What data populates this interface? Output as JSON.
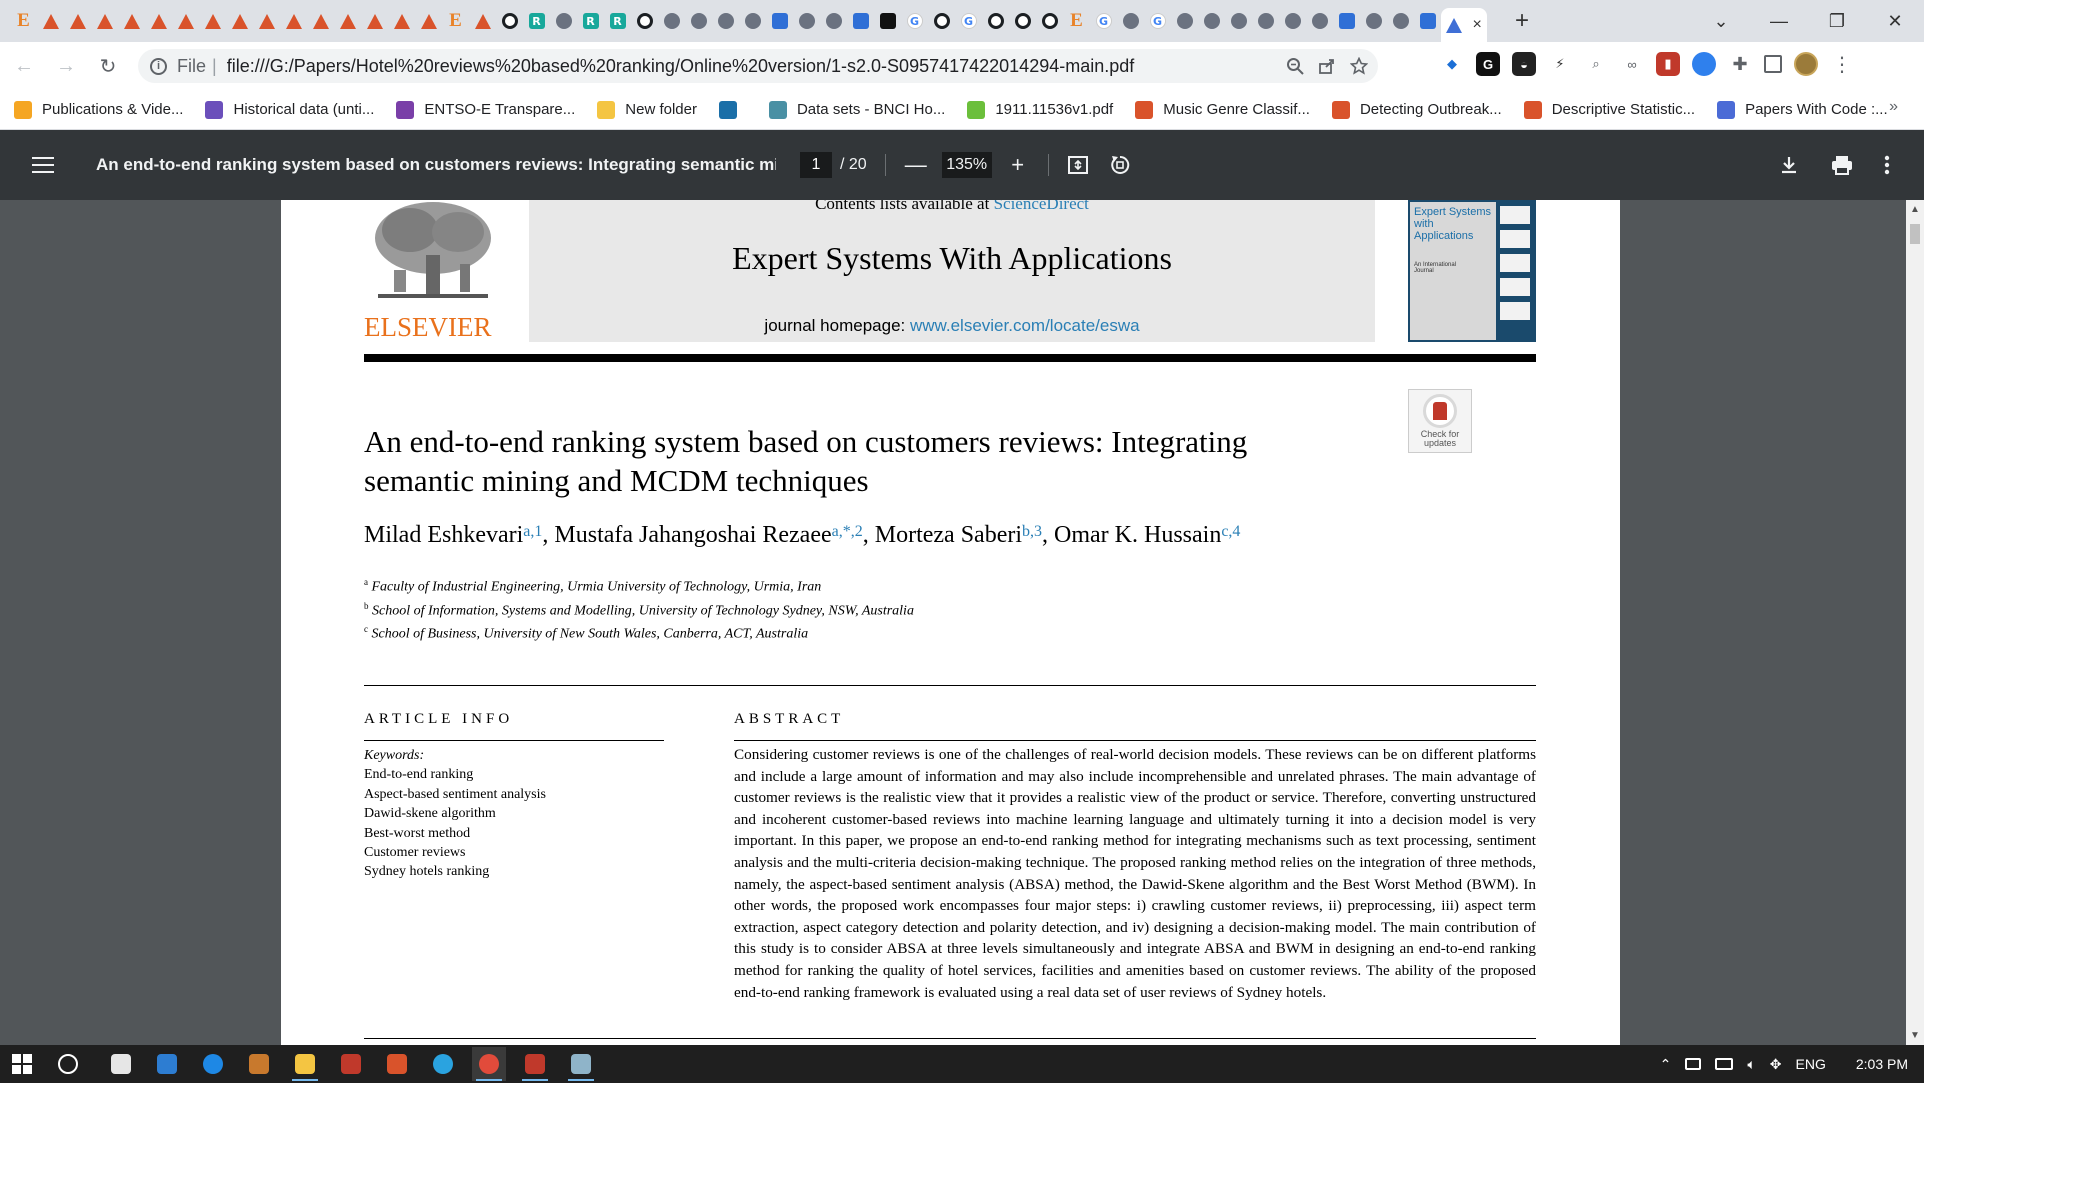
{
  "browser": {
    "tabs": [
      "E",
      "matlab",
      "matlab",
      "matlab",
      "matlab",
      "matlab",
      "matlab",
      "matlab",
      "matlab",
      "matlab",
      "matlab",
      "matlab",
      "matlab",
      "matlab",
      "matlab",
      "matlab",
      "E",
      "matlab",
      "gh",
      "rg",
      "page",
      "rg",
      "rg",
      "gh",
      "globe",
      "globe",
      "globe",
      "globe",
      "blue",
      "globe",
      "globe",
      "blue",
      "dark",
      "g",
      "gh",
      "g",
      "gh",
      "gh",
      "gh",
      "E",
      "g",
      "globe",
      "g",
      "globe",
      "globe",
      "globe",
      "globe",
      "globe",
      "globe",
      "blue",
      "globe",
      "globe",
      "blue"
    ],
    "active_tab_close": "×",
    "new_tab": "+",
    "window_controls": {
      "tab_search": "⌄",
      "minimize": "—",
      "restore": "❐",
      "close": "✕"
    },
    "nav": {
      "back": "←",
      "forward": "→",
      "reload": "↻"
    },
    "omnibox": {
      "scheme": "File",
      "url": "file:///G:/Papers/Hotel%20reviews%20based%20ranking/Online%20version/1-s2.0-S0957417422014294-main.pdf"
    },
    "menu": "⋮",
    "bookmarks": [
      {
        "label": "Publications & Vide...",
        "color": "#f5a623"
      },
      {
        "label": "Historical data (unti...",
        "color": "#6b4fbb"
      },
      {
        "label": "ENTSO-E Transpare...",
        "color": "#7a3fa8"
      },
      {
        "label": "New folder",
        "color": "#f4c542"
      },
      {
        "label": "",
        "color": "#1b6fa8"
      },
      {
        "label": "Data sets - BNCI Ho...",
        "color": "#4a90a4"
      },
      {
        "label": "1911.11536v1.pdf",
        "color": "#6bbf3b"
      },
      {
        "label": "Music Genre Classif...",
        "color": "#d9532b"
      },
      {
        "label": "Detecting Outbreak...",
        "color": "#d9532b"
      },
      {
        "label": "Descriptive Statistic...",
        "color": "#d9532b"
      },
      {
        "label": "Papers With Code :...",
        "color": "#4b6bd6"
      }
    ],
    "bookmarks_more": "»"
  },
  "pdf": {
    "title": "An end-to-end ranking system based on customers reviews: Integrating semantic mi...",
    "page": "1",
    "total_pages": "/ 20",
    "zoom": "135%",
    "zoom_out": "—",
    "zoom_in": "+"
  },
  "article": {
    "publisher": "ELSEVIER",
    "contents_prefix": "Contents lists available at ",
    "contents_link": "ScienceDirect",
    "journal": "Expert Systems With Applications",
    "homepage_prefix": "journal homepage: ",
    "homepage_url": "www.elsevier.com/locate/eswa",
    "cover_title": "Expert Systems with Applications",
    "cover_sub": "An International Journal",
    "check_updates": "Check for updates",
    "title": "An end-to-end ranking system based on customers reviews: Integrating semantic mining and MCDM techniques",
    "authors": [
      {
        "name": "Milad Eshkevari",
        "sup": "a,1",
        "sep": ", "
      },
      {
        "name": "Mustafa Jahangoshai Rezaee",
        "sup": "a,*,2",
        "sep": ", "
      },
      {
        "name": "Morteza Saberi",
        "sup": "b,3",
        "sep": ", "
      },
      {
        "name": "Omar K. Hussain",
        "sup": "c,4",
        "sep": ""
      }
    ],
    "affiliations": [
      {
        "sup": "a",
        "text": "Faculty of Industrial Engineering, Urmia University of Technology, Urmia, Iran"
      },
      {
        "sup": "b",
        "text": "School of Information, Systems and Modelling, University of Technology Sydney, NSW, Australia"
      },
      {
        "sup": "c",
        "text": "School of Business, University of New South Wales, Canberra, ACT, Australia"
      }
    ],
    "article_info_heading": "ARTICLE INFO",
    "keywords_label": "Keywords:",
    "keywords": [
      "End-to-end ranking",
      "Aspect-based sentiment analysis",
      "Dawid-skene algorithm",
      "Best-worst method",
      "Customer reviews",
      "Sydney hotels ranking"
    ],
    "abstract_heading": "ABSTRACT",
    "abstract": "Considering customer reviews is one of the challenges of real-world decision models. These reviews can be on different platforms and include a large amount of information and may also include incomprehensible and unrelated phrases. The main advantage of customer reviews is the realistic view that it provides a realistic view of the product or service. Therefore, converting unstructured and incoherent customer-based reviews into machine learning language and ultimately turning it into a decision model is very important. In this paper, we propose an end-to-end ranking method for integrating mechanisms such as text processing, sentiment analysis and the multi-criteria decision-making technique. The proposed ranking method relies on the integration of three methods, namely, the aspect-based sentiment analysis (ABSA) method, the Dawid-Skene algorithm and the Best Worst Method (BWM). In other words, the proposed work encompasses four major steps: i) crawling customer reviews, ii) preprocessing, iii) aspect term extraction, aspect category detection and polarity detection, and iv) designing a decision-making model. The main contribution of this study is to consider ABSA at three levels simultaneously and integrate ABSA and BWM in designing an end-to-end ranking method for ranking the quality of hotel services, facilities and amenities based on customer reviews. The ability of the proposed end-to-end ranking framework is evaluated using a real data set of user reviews of Sydney hotels."
  },
  "taskbar": {
    "apps": [
      {
        "name": "mail",
        "color": "#e6e6e6",
        "running": false
      },
      {
        "name": "app",
        "color": "#2d7dd2",
        "running": false
      },
      {
        "name": "edge",
        "color": "#1e88e5",
        "running": false
      },
      {
        "name": "app",
        "color": "#c8792d",
        "running": false
      },
      {
        "name": "explorer",
        "color": "#f4c542",
        "running": true
      },
      {
        "name": "app",
        "color": "#c0392b",
        "running": false
      },
      {
        "name": "matlab",
        "color": "#d9532b",
        "running": false
      },
      {
        "name": "telegram",
        "color": "#2aa3e0",
        "running": false
      },
      {
        "name": "chrome",
        "color": "#e14b3b",
        "running": true,
        "active": true
      },
      {
        "name": "app",
        "color": "#c0392b",
        "running": true
      },
      {
        "name": "app",
        "color": "#8fb4c9",
        "running": true
      }
    ],
    "tray_lang": "ENG",
    "time": "2:03 PM"
  }
}
